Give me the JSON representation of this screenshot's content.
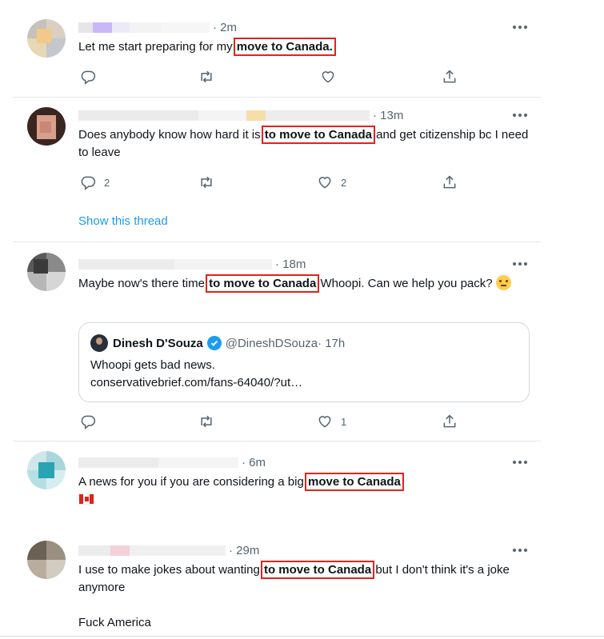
{
  "colors": {
    "accent": "#1d9bf0",
    "highlight_box": "#e0241b",
    "muted": "#536471",
    "text": "#0f1419"
  },
  "icons": {
    "reply": "reply-icon",
    "retweet": "retweet-icon",
    "like": "like-icon",
    "share": "share-icon",
    "more": "more-icon",
    "verified": "verified-badge-icon"
  },
  "tweets": [
    {
      "time": "2m",
      "text_before": "Let me start preparing for my ",
      "highlight": "move to Canada.",
      "text_after": "",
      "replies": "",
      "retweets": "",
      "likes": ""
    },
    {
      "time": "13m",
      "text_before": "Does anybody know how hard it is ",
      "highlight": "to move to Canada",
      "text_after": " and get citizenship bc I need to leave",
      "replies": "2",
      "retweets": "",
      "likes": "2",
      "thread_link": "Show this thread"
    },
    {
      "time": "18m",
      "text_before": "Maybe now's there time ",
      "highlight": "to move to Canada",
      "text_after": " Whoopi. Can we help you pack? ",
      "replies": "",
      "retweets": "",
      "likes": "1",
      "quote": {
        "name": "Dinesh D'Souza",
        "handle": "@DineshDSouza",
        "time": "17h",
        "line1": "Whoopi gets bad news.",
        "line2": "conservativebrief.com/fans-64040/?ut…"
      }
    },
    {
      "time": "6m",
      "text_before": "A news for you if you are considering a big ",
      "highlight": "move to Canada",
      "text_after": "!"
    },
    {
      "time": "29m",
      "text_before": "I use to make jokes about wanting ",
      "highlight": "to move to Canada",
      "text_after": " but I don't think it's a joke anymore",
      "text_extra": "Fuck America"
    }
  ]
}
